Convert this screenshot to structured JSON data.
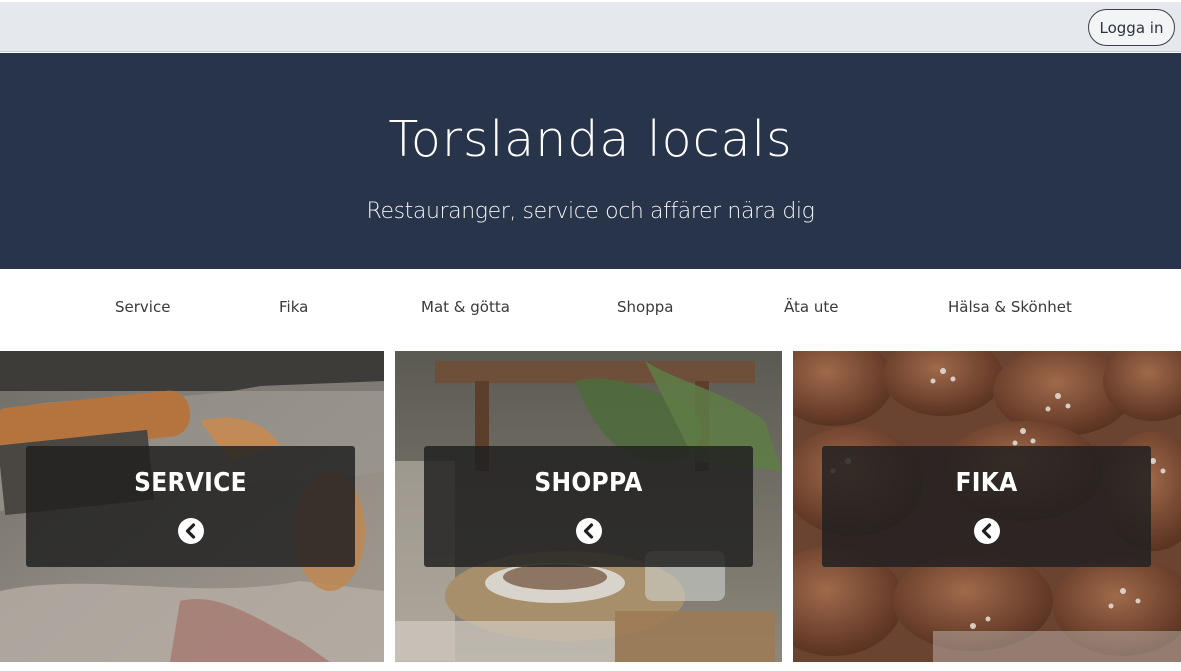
{
  "header": {
    "login_label": "Logga in"
  },
  "hero": {
    "title": "Torslanda locals",
    "subtitle": "Restauranger, service och affärer nära dig"
  },
  "nav": {
    "items": [
      {
        "label": "Service"
      },
      {
        "label": "Fika"
      },
      {
        "label": "Mat & götta"
      },
      {
        "label": "Shoppa"
      },
      {
        "label": "Äta ute"
      },
      {
        "label": "Hälsa & Skönhet"
      }
    ]
  },
  "tiles": [
    {
      "title": "SERVICE",
      "icon": "chevron-left-circle-icon"
    },
    {
      "title": "SHOPPA",
      "icon": "chevron-left-circle-icon"
    },
    {
      "title": "FIKA",
      "icon": "chevron-left-circle-icon"
    }
  ],
  "colors": {
    "hero_bg": "#28344a",
    "topbar_bg": "#e5e8ec",
    "caption_bg": "#202020"
  }
}
